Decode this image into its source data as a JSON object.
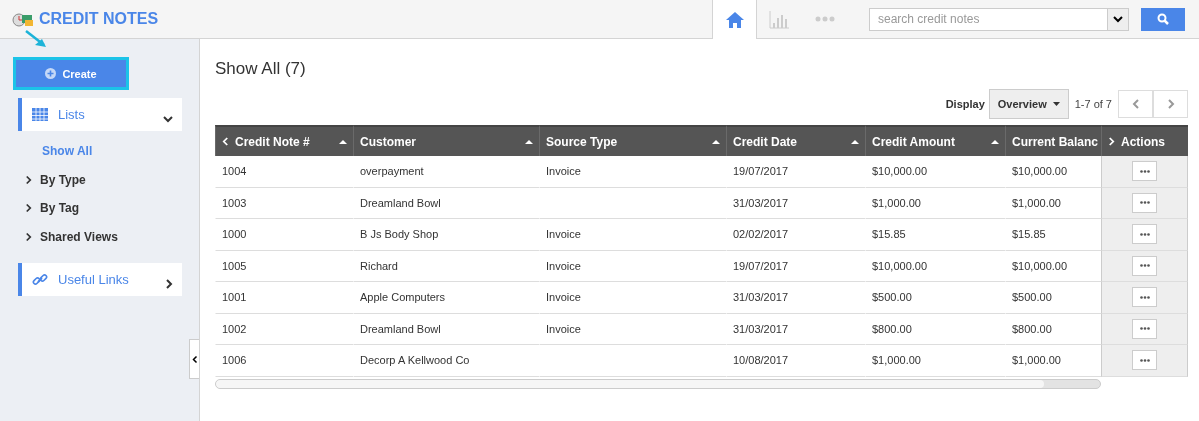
{
  "app": {
    "title": "CREDIT NOTES"
  },
  "nav_tabs": [
    {
      "kind": "home",
      "selected": true
    },
    {
      "kind": "chart",
      "selected": false
    },
    {
      "kind": "more",
      "selected": false
    }
  ],
  "search": {
    "placeholder": "search credit notes"
  },
  "sidebar": {
    "create_label": "Create",
    "sections": [
      {
        "kind": "lists",
        "label": "Lists",
        "expanded": true,
        "children": [
          {
            "label": "Show All",
            "selected": true
          },
          {
            "label": "By Type",
            "selected": false
          },
          {
            "label": "By Tag",
            "selected": false
          },
          {
            "label": "Shared Views",
            "selected": false
          }
        ]
      },
      {
        "kind": "links",
        "label": "Useful Links",
        "expanded": false
      }
    ]
  },
  "content": {
    "heading": "Show All (7)",
    "display_label": "Display",
    "display_value": "Overview",
    "page_range": "1-7 of 7"
  },
  "table": {
    "columns": [
      {
        "label": "Credit Note #",
        "sortable": true
      },
      {
        "label": "Customer",
        "sortable": true
      },
      {
        "label": "Source Type",
        "sortable": true
      },
      {
        "label": "Credit Date",
        "sortable": true
      },
      {
        "label": "Credit Amount",
        "sortable": true
      },
      {
        "label": "Current Balanc"
      },
      {
        "label": "Actions",
        "sortable": false
      }
    ],
    "rows": [
      [
        "1004",
        "overpayment",
        "Invoice",
        "19/07/2017",
        "$10,000.00",
        "$10,000.00"
      ],
      [
        "1003",
        "Dreamland Bowl",
        "",
        "31/03/2017",
        "$1,000.00",
        "$1,000.00"
      ],
      [
        "1000",
        "B Js Body Shop",
        "Invoice",
        "02/02/2017",
        "$15.85",
        "$15.85"
      ],
      [
        "1005",
        "Richard",
        "Invoice",
        "19/07/2017",
        "$10,000.00",
        "$10,000.00"
      ],
      [
        "1001",
        "Apple Computers",
        "Invoice",
        "31/03/2017",
        "$500.00",
        "$500.00"
      ],
      [
        "1002",
        "Dreamland Bowl",
        "Invoice",
        "31/03/2017",
        "$800.00",
        "$800.00"
      ],
      [
        "1006",
        "Decorp A Kellwood Co",
        "",
        "10/08/2017",
        "$1,000.00",
        "$1,000.00"
      ]
    ]
  }
}
